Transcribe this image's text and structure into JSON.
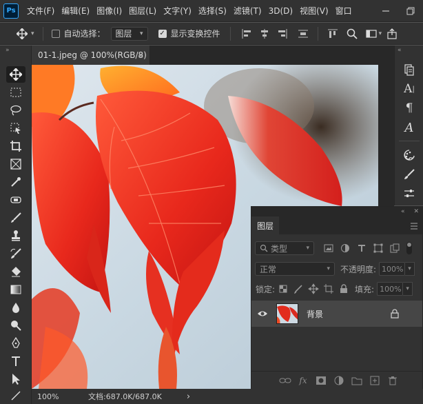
{
  "menubar": {
    "logo": "Ps",
    "items": [
      "文件(F)",
      "编辑(E)",
      "图像(I)",
      "图层(L)",
      "文字(Y)",
      "选择(S)",
      "滤镜(T)",
      "3D(D)",
      "视图(V)",
      "窗口"
    ],
    "window_buttons": [
      "minimize-icon",
      "restore-icon"
    ]
  },
  "options": {
    "auto_select_label": "自动选择：",
    "auto_select_checked": false,
    "auto_select_target": "图层",
    "show_transform_label": "显示变换控件",
    "show_transform_checked": true
  },
  "toolbar": {
    "tools": [
      "move-tool",
      "marquee-tool",
      "lasso-tool",
      "object-selection-tool",
      "crop-tool",
      "frame-tool",
      "eyedropper-tool",
      "healing-brush-tool",
      "brush-tool",
      "clone-stamp-tool",
      "history-brush-tool",
      "eraser-tool",
      "gradient-tool",
      "blur-tool",
      "dodge-tool",
      "pen-tool",
      "type-tool",
      "path-selection-tool",
      "line-tool"
    ],
    "active_tool": "move-tool"
  },
  "document": {
    "tab_title": "01-1.jpeg @ 100%(RGB/8)",
    "close": "×"
  },
  "status": {
    "zoom": "100%",
    "doc_info": "文档:687.0K/687.0K",
    "arrow": "›"
  },
  "layers_panel": {
    "collapse": "«",
    "tab": "图层",
    "filter_placeholder": "类型",
    "blend_mode": "正常",
    "opacity_label": "不透明度:",
    "opacity_value": "100%",
    "lock_label": "锁定:",
    "fill_label": "填充:",
    "fill_value": "100%",
    "layers": [
      {
        "name": "背景",
        "visible": true,
        "locked": true
      }
    ],
    "footer_icons": [
      "link-icon",
      "fx-icon",
      "mask-icon",
      "adjustment-icon",
      "group-icon",
      "new-layer-icon",
      "delete-icon"
    ],
    "fx_label": "fx"
  },
  "colors": {
    "accent": "#31a8ff",
    "panel": "#323232",
    "dark": "#282828"
  }
}
